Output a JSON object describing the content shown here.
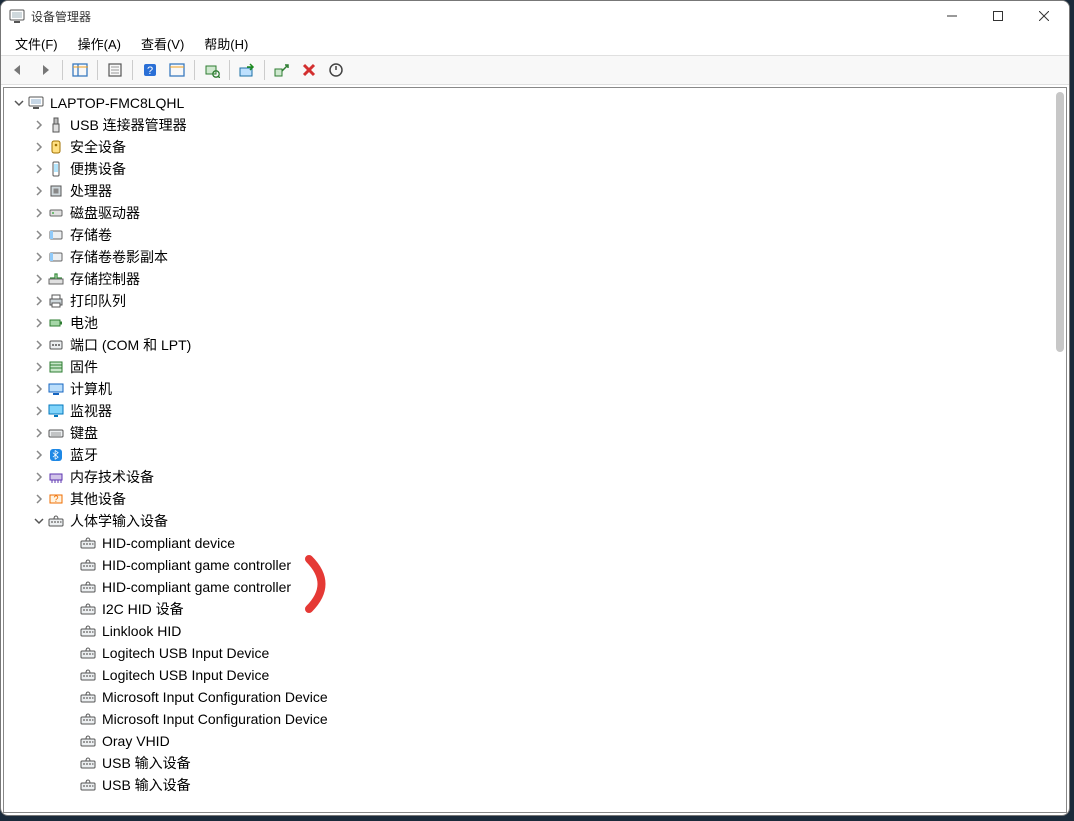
{
  "window": {
    "title": "设备管理器"
  },
  "menus": {
    "file": "文件(F)",
    "action": "操作(A)",
    "view": "查看(V)",
    "help": "帮助(H)"
  },
  "tree": {
    "root": "LAPTOP-FMC8LQHL",
    "categories": [
      {
        "icon": "usb",
        "label": "USB 连接器管理器"
      },
      {
        "icon": "security",
        "label": "安全设备"
      },
      {
        "icon": "portable",
        "label": "便携设备"
      },
      {
        "icon": "cpu",
        "label": "处理器"
      },
      {
        "icon": "diskdrive",
        "label": "磁盘驱动器"
      },
      {
        "icon": "volume",
        "label": "存储卷"
      },
      {
        "icon": "volume",
        "label": "存储卷卷影副本"
      },
      {
        "icon": "controller",
        "label": "存储控制器"
      },
      {
        "icon": "printer",
        "label": "打印队列"
      },
      {
        "icon": "battery",
        "label": "电池"
      },
      {
        "icon": "port",
        "label": "端口 (COM 和 LPT)"
      },
      {
        "icon": "firmware",
        "label": "固件"
      },
      {
        "icon": "computer",
        "label": "计算机"
      },
      {
        "icon": "monitor",
        "label": "监视器"
      },
      {
        "icon": "keyboard",
        "label": "键盘"
      },
      {
        "icon": "bluetooth",
        "label": "蓝牙"
      },
      {
        "icon": "memory",
        "label": "内存技术设备"
      },
      {
        "icon": "other",
        "label": "其他设备"
      }
    ],
    "expanded_category": {
      "icon": "hid",
      "label": "人体学输入设备"
    },
    "hid_children": [
      "HID-compliant device",
      "HID-compliant game controller",
      "HID-compliant game controller",
      "I2C HID 设备",
      "Linklook HID",
      "Logitech USB Input Device",
      "Logitech USB Input Device",
      "Microsoft Input Configuration Device",
      "Microsoft Input Configuration Device",
      "Oray VHID",
      "USB 输入设备",
      "USB 输入设备"
    ]
  }
}
